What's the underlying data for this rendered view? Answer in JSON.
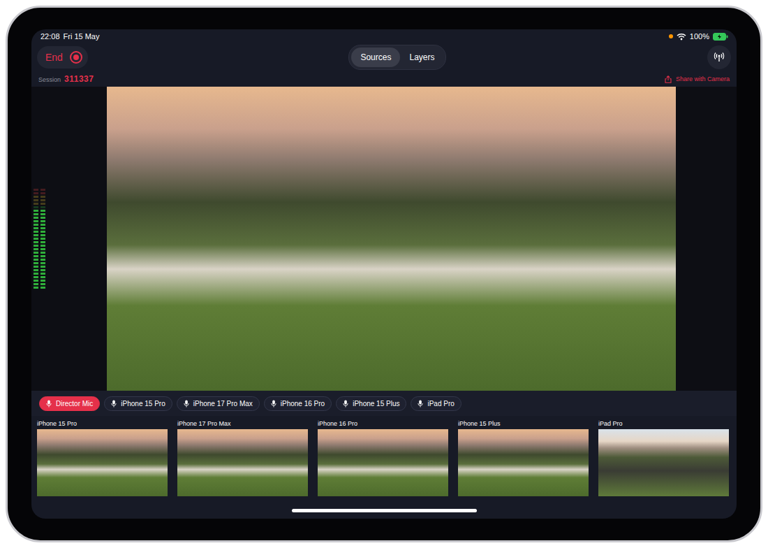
{
  "status_bar": {
    "time": "22:08",
    "date": "Fri 15 May",
    "battery": "100%",
    "recording_indicator": true
  },
  "toolbar": {
    "end_button": "End",
    "recording": true,
    "tabs": [
      {
        "label": "Sources",
        "selected": true
      },
      {
        "label": "Layers",
        "selected": false
      }
    ]
  },
  "session": {
    "label": "Session",
    "code": "311337"
  },
  "share_button": "Share with Camera",
  "meter": {
    "channels": [
      {
        "level": 0.8
      },
      {
        "level": 0.78
      }
    ]
  },
  "mics": [
    {
      "label": "Director Mic",
      "selected": true
    },
    {
      "label": "iPhone 15 Pro",
      "selected": false
    },
    {
      "label": "iPhone 17 Pro Max",
      "selected": false
    },
    {
      "label": "iPhone 16 Pro",
      "selected": false
    },
    {
      "label": "iPhone 15 Plus",
      "selected": false
    },
    {
      "label": "iPad Pro",
      "selected": false
    }
  ],
  "sources": [
    {
      "label": "iPhone 15 Pro"
    },
    {
      "label": "iPhone 17 Pro Max"
    },
    {
      "label": "iPhone 16 Pro"
    },
    {
      "label": "iPhone 15 Plus"
    },
    {
      "label": "iPad Pro"
    }
  ]
}
